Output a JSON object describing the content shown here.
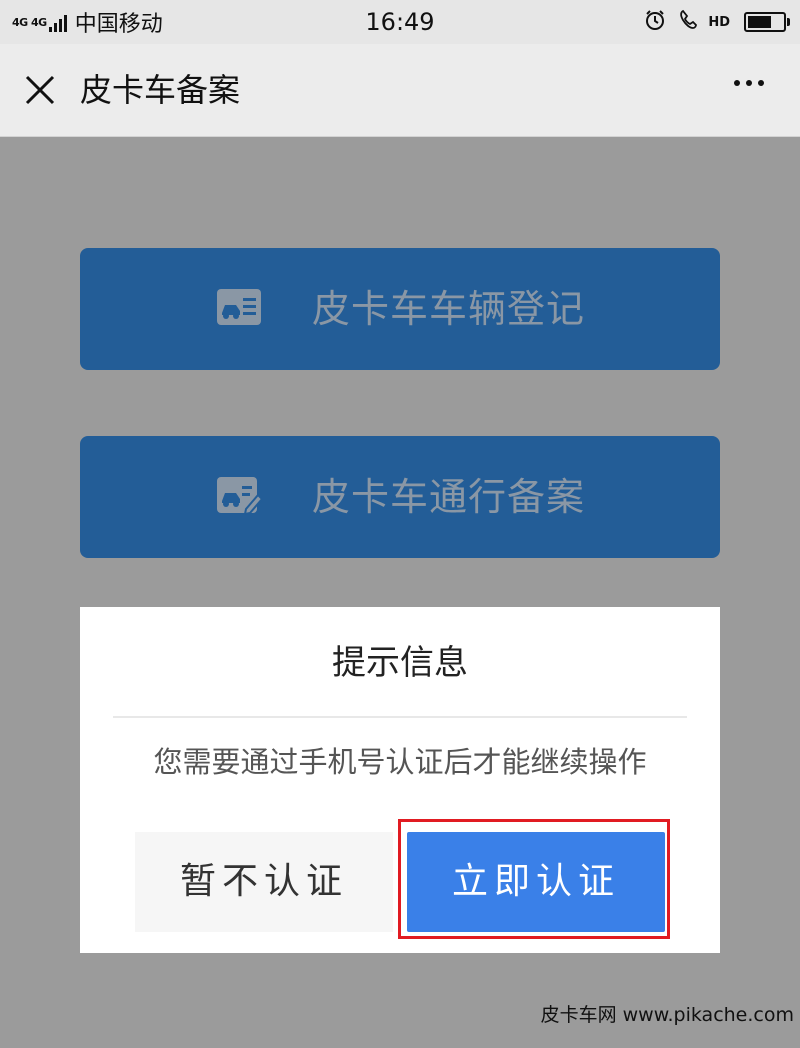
{
  "status_bar": {
    "network_label": "4G 4G",
    "carrier": "中国移动",
    "time": "16:49",
    "icons": [
      "alarm-icon",
      "hd-call-icon",
      "battery-icon"
    ],
    "hd_label": "HD",
    "battery_level": 0.8
  },
  "nav": {
    "title": "皮卡车备案",
    "close_icon": "close-icon",
    "more_icon": "more-icon"
  },
  "menu": [
    {
      "label": "皮卡车车辆登记",
      "icon": "vehicle-card-icon"
    },
    {
      "label": "皮卡车通行备案",
      "icon": "vehicle-edit-icon"
    }
  ],
  "dialog": {
    "title": "提示信息",
    "message": "您需要通过手机号认证后才能继续操作",
    "cancel_label": "暂不认证",
    "confirm_label": "立即认证"
  },
  "watermark": "皮卡车网 www.pikache.com",
  "colors": {
    "overlay": "#9b9b9b",
    "menu_button": "#235d97",
    "confirm_button": "#3a80e8",
    "highlight": "#e11b22"
  }
}
